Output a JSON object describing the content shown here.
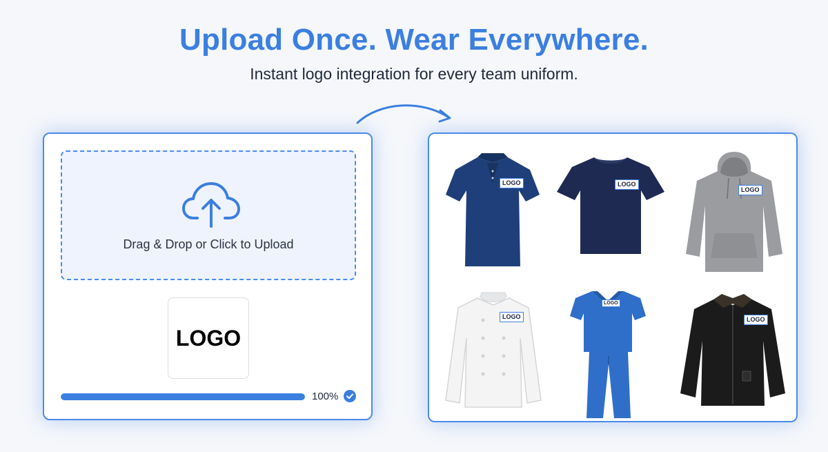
{
  "hero": {
    "title": "Upload Once. Wear Everywhere.",
    "subtitle": "Instant logo integration for every team uniform."
  },
  "upload": {
    "dropzone_label": "Drag & Drop or Click to Upload",
    "logo_preview_text": "LOGO",
    "progress_percent": 100,
    "progress_label": "100%",
    "status_icon": "check-circle-icon"
  },
  "gallery": {
    "items": [
      {
        "name": "Polo shirt",
        "patch": "LOGO",
        "color": "#1f3f7a"
      },
      {
        "name": "T-shirt",
        "patch": "LOGO",
        "color": "#1e2a52"
      },
      {
        "name": "Hoodie",
        "patch": "LOGO",
        "color": "#9a9c9f"
      },
      {
        "name": "Chef coat",
        "patch": "LOGO",
        "color": "#f4f4f4"
      },
      {
        "name": "Scrubs",
        "patch": "LOGO",
        "color": "#2f6fc9"
      },
      {
        "name": "Work jacket",
        "patch": "LOGO",
        "color": "#1b1b1b"
      }
    ]
  },
  "colors": {
    "accent": "#3b7fe0",
    "text": "#222a3a",
    "dropzone_bg": "#eef3fd"
  }
}
